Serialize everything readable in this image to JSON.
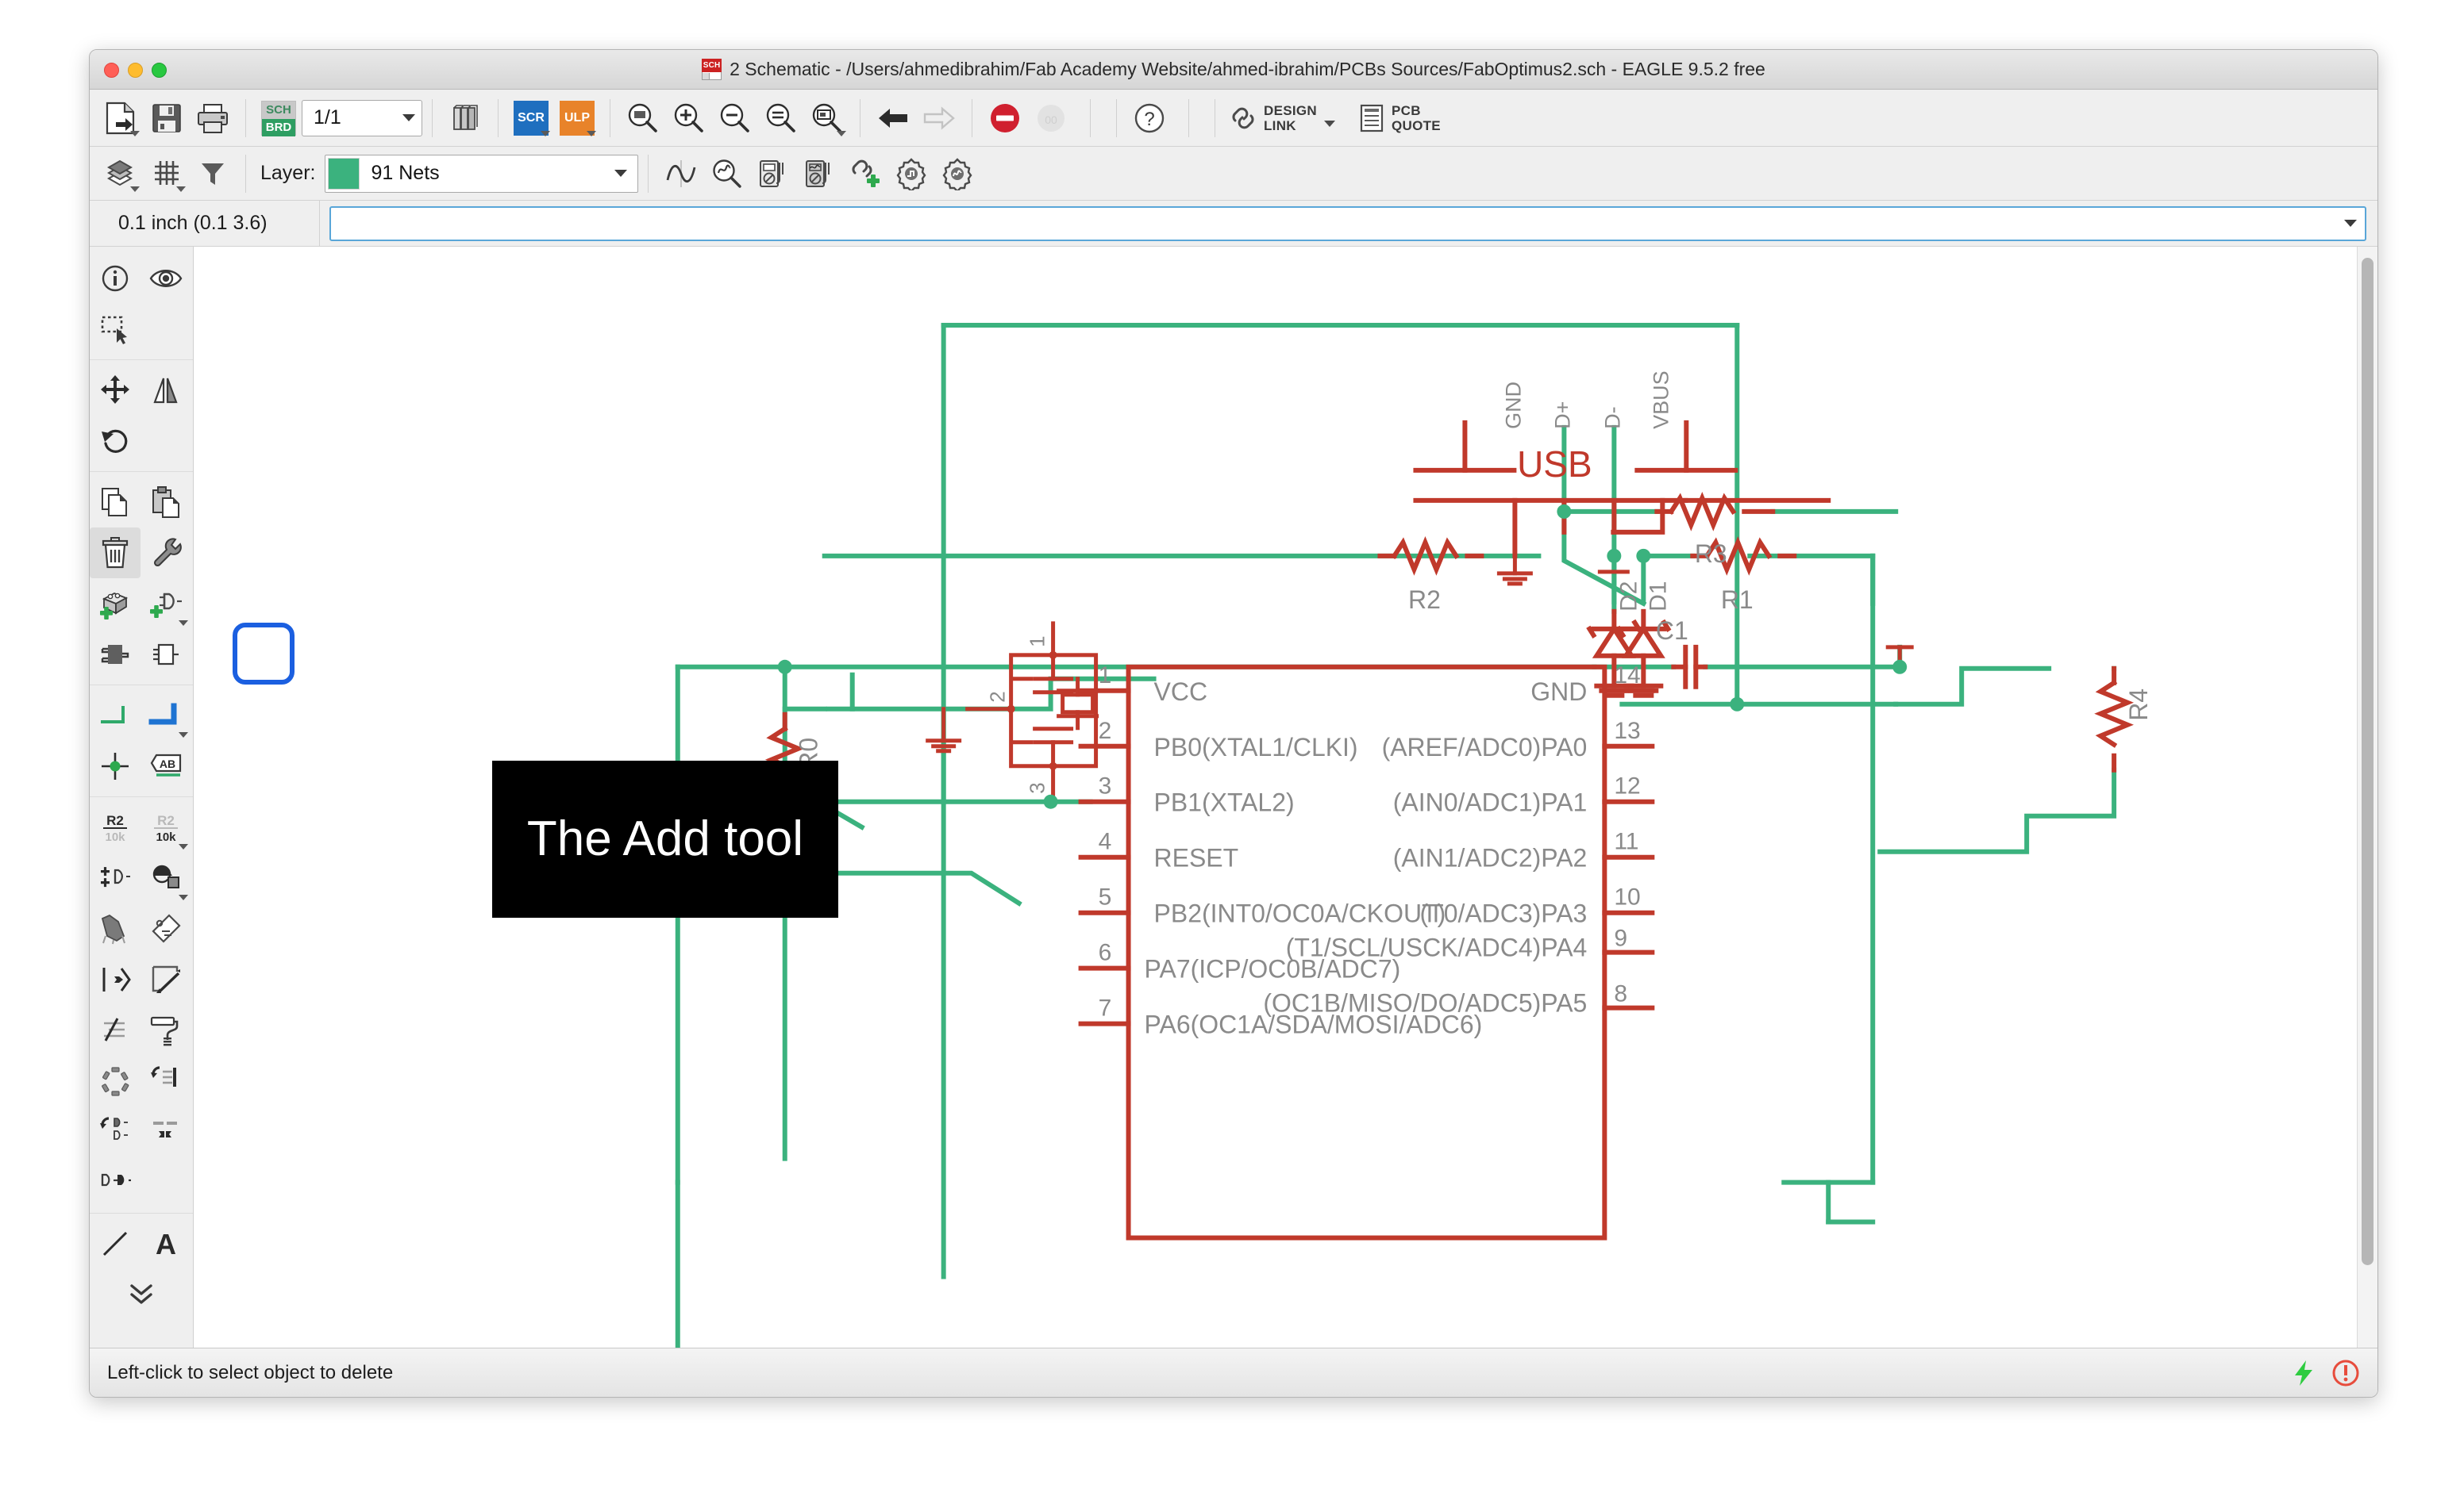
{
  "window": {
    "title": "2 Schematic - /Users/ahmedibrahim/Fab Academy Website/ahmed-ibrahim/PCBs Sources/FabOptimus2.sch - EAGLE 9.5.2 free",
    "badge_label": "SCH",
    "traffic": [
      "close-button",
      "minimize-button",
      "maximize-button"
    ]
  },
  "toolbar": {
    "sheet_value": "1/1",
    "sch_brd_top": "SCH",
    "sch_brd_bottom": "BRD",
    "scr_label": "SCR",
    "ulp_label": "ULP",
    "design_link_line1": "DESIGN",
    "design_link_line2": "LINK",
    "pcb_quote_line1": "PCB",
    "pcb_quote_line2": "QUOTE",
    "items": [
      {
        "name": "open-file-button",
        "icon": "file-export-icon"
      },
      {
        "name": "save-button",
        "icon": "floppy-disk-icon"
      },
      {
        "name": "print-button",
        "icon": "printer-icon"
      },
      {
        "name": "switch-to-board-button",
        "icon": "sch-brd-icon"
      },
      {
        "name": "sheet-selector",
        "icon": "combobox"
      },
      {
        "name": "library-manager-button",
        "icon": "books-icon"
      },
      {
        "name": "script-button",
        "icon": "scr-icon"
      },
      {
        "name": "ulp-button",
        "icon": "ulp-icon"
      },
      {
        "name": "zoom-fit-button",
        "icon": "zoom-fit-icon"
      },
      {
        "name": "zoom-in-button",
        "icon": "zoom-in-icon"
      },
      {
        "name": "zoom-out-button",
        "icon": "zoom-out-icon"
      },
      {
        "name": "zoom-redraw-button",
        "icon": "zoom-redraw-icon"
      },
      {
        "name": "zoom-select-button",
        "icon": "zoom-select-icon"
      },
      {
        "name": "undo-button",
        "icon": "undo-arrow-icon"
      },
      {
        "name": "redo-button",
        "icon": "redo-arrow-icon"
      },
      {
        "name": "stop-button",
        "icon": "stop-icon"
      },
      {
        "name": "drc-button",
        "icon": "drc-icon"
      },
      {
        "name": "help-button",
        "icon": "question-mark-icon"
      }
    ]
  },
  "layer_bar": {
    "label": "Layer:",
    "selected_layer": "91 Nets",
    "swatch_color": "#3bb27e",
    "items": [
      {
        "name": "display-layers-button",
        "icon": "layers-icon"
      },
      {
        "name": "grid-button",
        "icon": "grid-icon"
      },
      {
        "name": "filter-button",
        "icon": "funnel-icon"
      },
      {
        "name": "simulate-button",
        "icon": "waveform-icon"
      },
      {
        "name": "probe-button",
        "icon": "waveform-magnifier-icon"
      },
      {
        "name": "dc-meter-button",
        "icon": "multimeter-icon"
      },
      {
        "name": "ac-meter-button",
        "icon": "ac-multimeter-icon"
      },
      {
        "name": "add-link-button",
        "icon": "link-plus-icon"
      },
      {
        "name": "dc-settings-button",
        "icon": "gear-step-icon"
      },
      {
        "name": "ac-settings-button",
        "icon": "gear-wave-icon"
      }
    ]
  },
  "command_bar": {
    "coordinate": "0.1 inch (0.1 3.6)",
    "command_value": "",
    "command_placeholder": ""
  },
  "left_toolbar": {
    "highlight_tool": "add-tool",
    "active_tool": "delete-tool",
    "groups": [
      {
        "name": "inspect-group",
        "tools": [
          {
            "name": "info-tool",
            "icon": "info-circle-icon"
          },
          {
            "name": "show-tool",
            "icon": "eye-icon"
          },
          {
            "name": "group-tool",
            "icon": "marquee-select-icon"
          }
        ]
      },
      {
        "name": "transform-group",
        "tools": [
          {
            "name": "move-tool",
            "icon": "move-arrows-icon"
          },
          {
            "name": "mirror-tool",
            "icon": "mirror-icon"
          },
          {
            "name": "rotate-tool",
            "icon": "rotate-ccw-icon"
          }
        ]
      },
      {
        "name": "edit-group",
        "tools": [
          {
            "name": "copy-tool",
            "icon": "copy-pages-icon"
          },
          {
            "name": "paste-tool",
            "icon": "clipboard-paste-icon"
          },
          {
            "name": "delete-tool",
            "icon": "trash-can-icon"
          },
          {
            "name": "change-tool",
            "icon": "wrench-icon"
          },
          {
            "name": "add-part-tool",
            "icon": "package-plus-icon"
          },
          {
            "name": "add-tool",
            "icon": "gate-plus-icon"
          },
          {
            "name": "replace-tool",
            "icon": "chip-filled-icon"
          },
          {
            "name": "invoke-tool",
            "icon": "chip-outline-icon"
          }
        ]
      },
      {
        "name": "net-group",
        "tools": [
          {
            "name": "net-tool",
            "icon": "green-net-corner-icon"
          },
          {
            "name": "bus-tool",
            "icon": "blue-bus-corner-icon"
          },
          {
            "name": "junction-tool",
            "icon": "junction-dot-icon"
          },
          {
            "name": "label-tool",
            "icon": "label-ab-icon"
          }
        ]
      },
      {
        "name": "attribute-group",
        "tools": [
          {
            "name": "name-tool",
            "icon": "name-r2-icon"
          },
          {
            "name": "value-tool",
            "icon": "value-10k-icon"
          },
          {
            "name": "gateswap-tool",
            "icon": "gate-swap-icon"
          },
          {
            "name": "smash-tool",
            "icon": "smash-icon"
          },
          {
            "name": "miter-tool",
            "icon": "miter-icon"
          },
          {
            "name": "attribute-tool",
            "icon": "tag-icon"
          },
          {
            "name": "split-tool",
            "icon": "split-arrow-icon"
          },
          {
            "name": "meander-tool",
            "icon": "corner-line-icon"
          },
          {
            "name": "dimension-tool",
            "icon": "dimension-icon"
          },
          {
            "name": "paint-tool",
            "icon": "paint-roller-icon"
          },
          {
            "name": "array-tool",
            "icon": "circular-array-icon"
          },
          {
            "name": "rename-net-tool",
            "icon": "rotate-list-icon"
          },
          {
            "name": "swap-gate-tool",
            "icon": "rotate-gate-icon"
          },
          {
            "name": "align-tool",
            "icon": "align-arrows-icon"
          },
          {
            "name": "replace-gate-tool",
            "icon": "gate-replace-icon"
          }
        ]
      },
      {
        "name": "draw-group",
        "tools": [
          {
            "name": "line-tool",
            "icon": "diagonal-line-icon"
          },
          {
            "name": "text-tool",
            "icon": "letter-a-icon"
          },
          {
            "name": "more-tools-button",
            "icon": "chevron-double-down-icon"
          }
        ]
      }
    ]
  },
  "annotation": {
    "text": "The Add tool",
    "background": "#000000",
    "color": "#ffffff"
  },
  "schematic": {
    "wire_color": "#3bb27e",
    "symbol_color": "#c0392b",
    "text_color": "#8a8a8a",
    "name_color": "#c0392b",
    "connector": {
      "name": "USB",
      "pins": [
        "GND",
        "D+",
        "D-",
        "VBUS"
      ]
    },
    "resistors": [
      {
        "name": "R0"
      },
      {
        "name": "R1"
      },
      {
        "name": "R2"
      },
      {
        "name": "R3"
      },
      {
        "name": "R4"
      }
    ],
    "diodes": [
      {
        "name": "D1"
      },
      {
        "name": "D2"
      }
    ],
    "capacitors": [
      {
        "name": "C1"
      }
    ],
    "resonator": {
      "pins": [
        "1",
        "2",
        "3"
      ]
    },
    "ic": {
      "left_pins": [
        {
          "number": "1",
          "label": "VCC"
        },
        {
          "number": "2",
          "label": "PB0(XTAL1/CLKI)"
        },
        {
          "number": "3",
          "label": "PB1(XTAL2)"
        },
        {
          "number": "4",
          "label": "RESET"
        },
        {
          "number": "5",
          "label": "PB2(INT0/OC0A/CKOUT)"
        },
        {
          "number": "6",
          "label": "PA7(ICP/OC0B/ADC7)"
        },
        {
          "number": "7",
          "label": "PA6(OC1A/SDA/MOSI/ADC6)"
        }
      ],
      "right_pins": [
        {
          "number": "14",
          "label": "GND"
        },
        {
          "number": "13",
          "label": "(AREF/ADC0)PA0"
        },
        {
          "number": "12",
          "label": "(AIN0/ADC1)PA1"
        },
        {
          "number": "11",
          "label": "(AIN1/ADC2)PA2"
        },
        {
          "number": "10",
          "label": "(T0/ADC3)PA3"
        },
        {
          "number": "9",
          "label": "(T1/SCL/USCK/ADC4)PA4"
        },
        {
          "number": "8",
          "label": "(OC1B/MISO/DO/ADC5)PA5"
        }
      ]
    }
  },
  "status_bar": {
    "message": "Left-click to select object to delete",
    "icons": [
      {
        "name": "lightning-bolt-icon",
        "color": "#2ecc40"
      },
      {
        "name": "warning-circle-icon",
        "color": "#e74c3c"
      }
    ]
  }
}
